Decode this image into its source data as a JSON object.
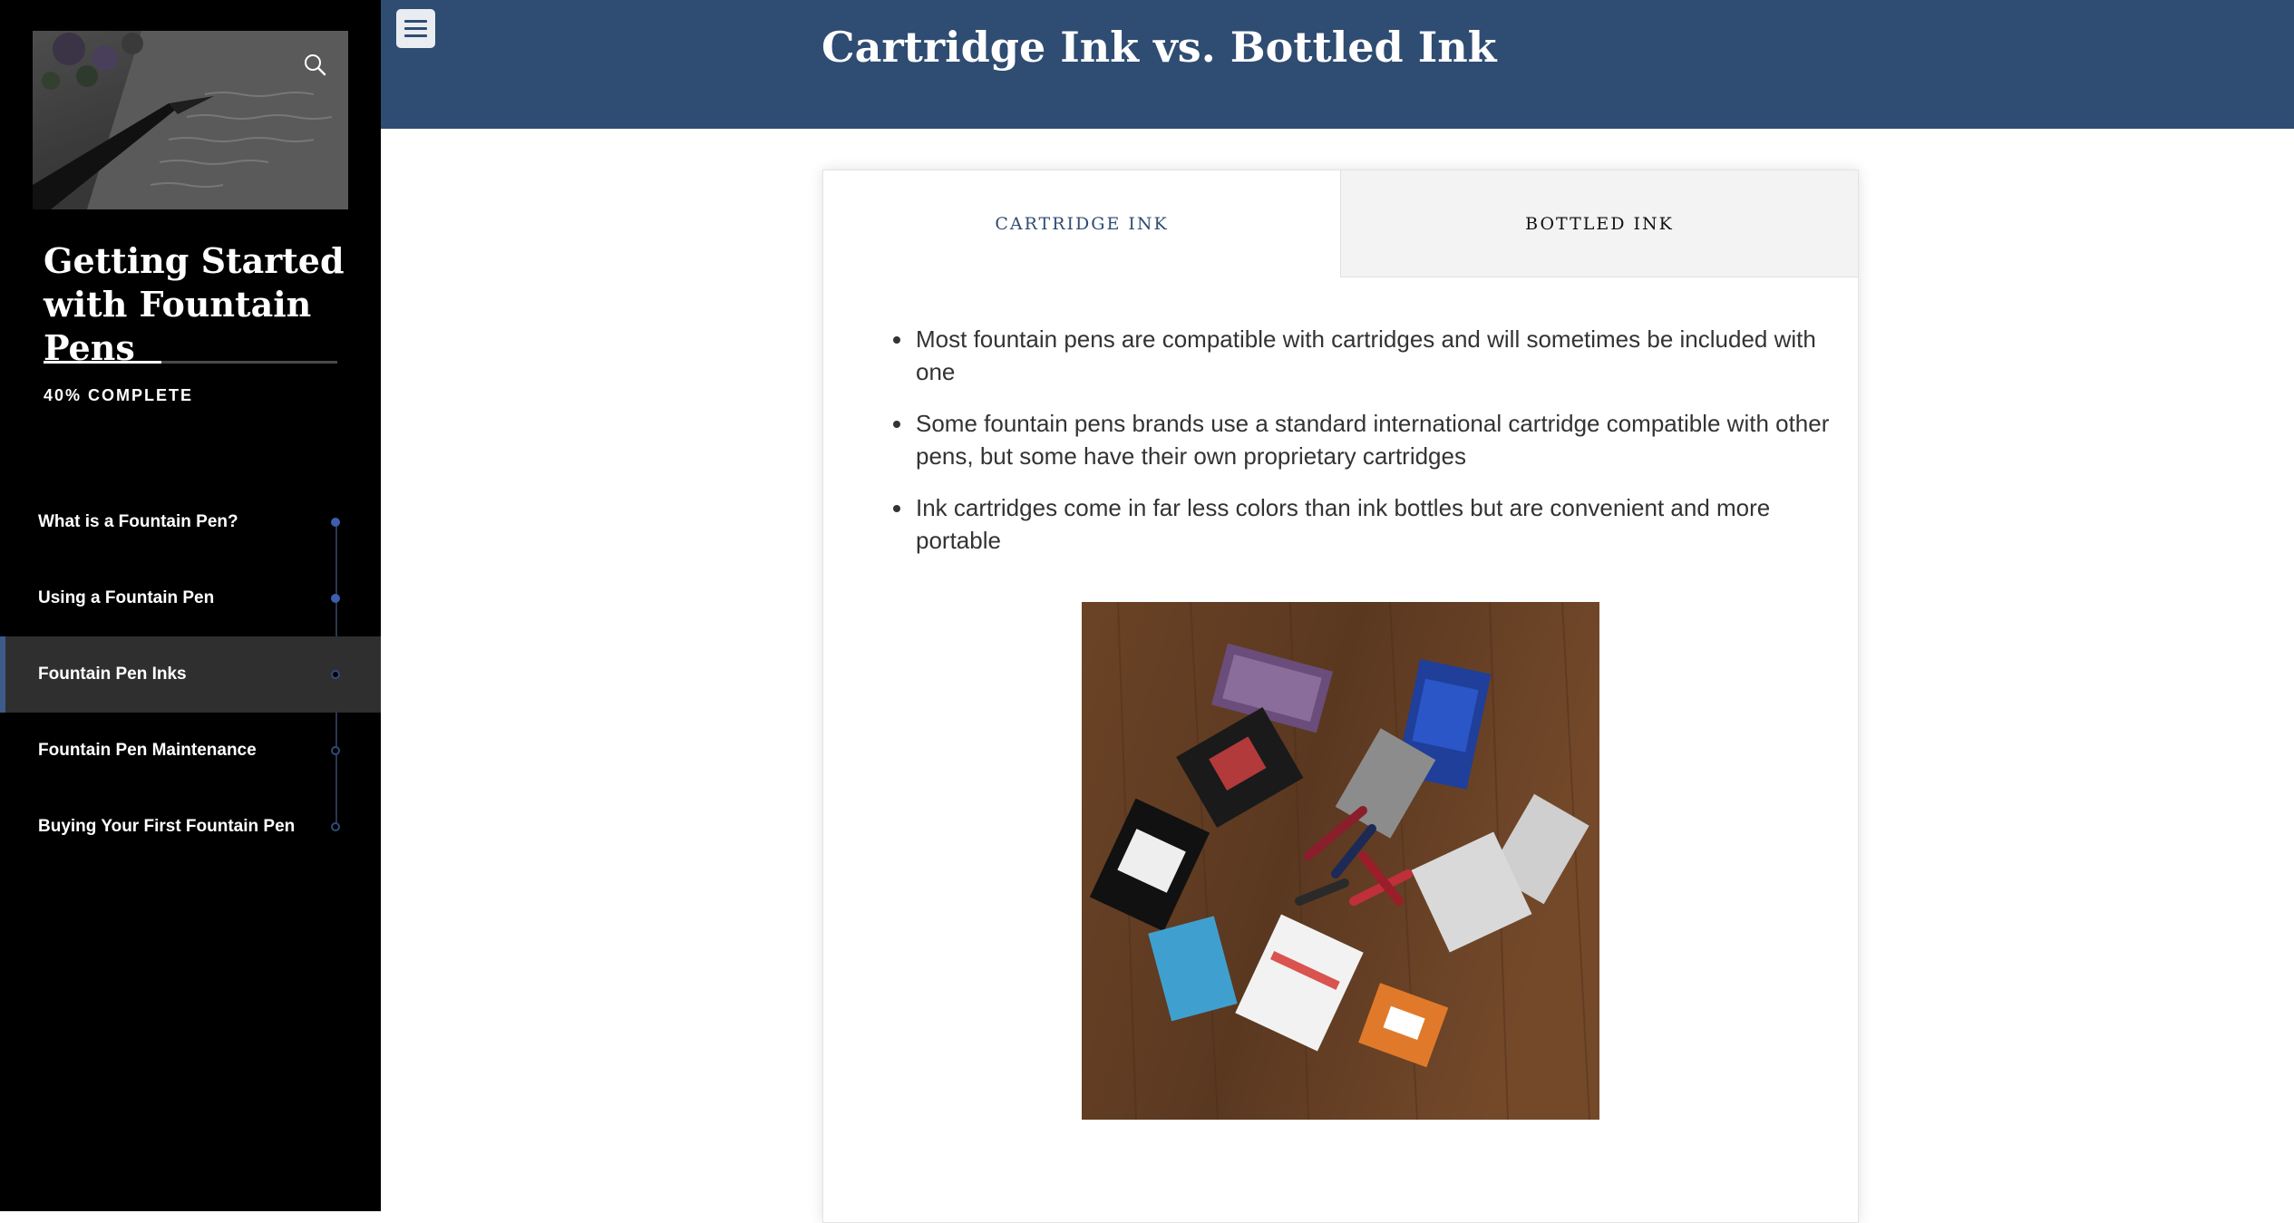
{
  "sidebar": {
    "course_title": "Getting Started with Fountain Pens",
    "progress_label": "40% COMPLETE",
    "progress_fraction": 0.4,
    "search_icon": "search-icon",
    "items": [
      {
        "label": "What is a Fountain Pen?",
        "status": "complete"
      },
      {
        "label": "Using a Fountain Pen",
        "status": "complete"
      },
      {
        "label": "Fountain Pen Inks",
        "status": "current"
      },
      {
        "label": "Fountain Pen Maintenance",
        "status": "incomplete"
      },
      {
        "label": "Buying Your First Fountain Pen",
        "status": "incomplete"
      }
    ]
  },
  "header": {
    "menu_icon": "hamburger-menu-icon",
    "title": "Cartridge Ink vs. Bottled Ink"
  },
  "tabs": [
    {
      "label": "CARTRIDGE INK",
      "active": true
    },
    {
      "label": "BOTTLED INK",
      "active": false
    }
  ],
  "content": {
    "bullets": [
      "Most fountain pens are compatible with cartridges and will sometimes be included with one",
      "Some fountain pens brands use a standard international cartridge compatible with other pens, but some have their own proprietary cartridges",
      "Ink cartridges come in far less colors than ink bottles but are convenient and more portable"
    ]
  },
  "colors": {
    "header_bg": "#2f4c72",
    "sidebar_bg": "#000000",
    "active_nav_bg": "#2f2f2f",
    "active_tab_text": "#2f4c72",
    "progress_dot": "#3b5fae"
  }
}
